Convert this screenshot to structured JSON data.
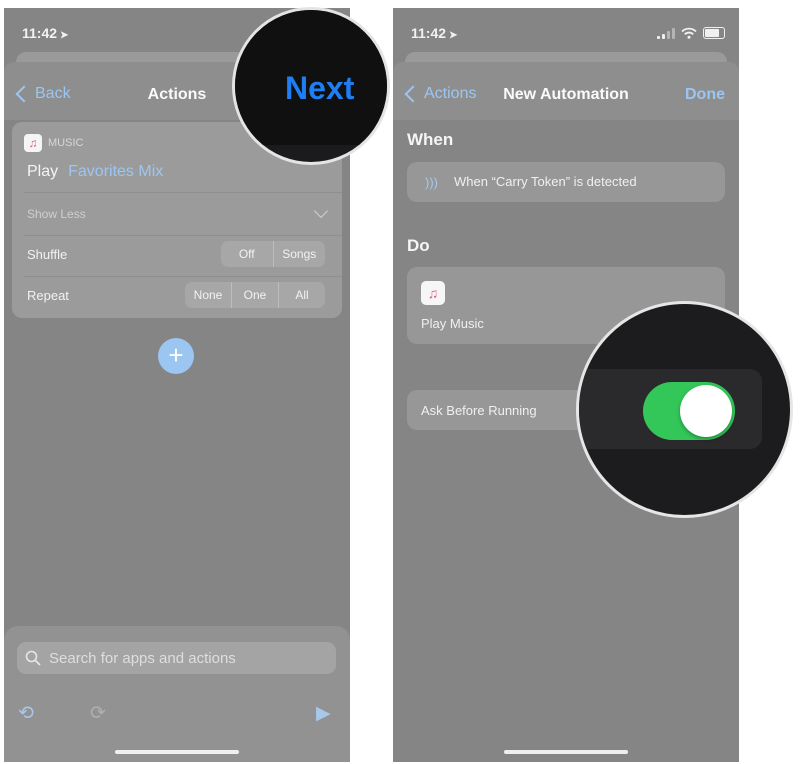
{
  "left": {
    "status": {
      "time": "11:42"
    },
    "nav": {
      "back": "Back",
      "title": "Actions",
      "next": "Next"
    },
    "action_card": {
      "app_name": "MUSIC",
      "action": "Play",
      "parameter": "Favorites Mix",
      "show_less": "Show Less",
      "shuffle": {
        "label": "Shuffle",
        "options": [
          "Off",
          "Songs"
        ]
      },
      "repeat": {
        "label": "Repeat",
        "options": [
          "None",
          "One",
          "All"
        ]
      }
    },
    "add_button": "+",
    "search": {
      "placeholder": "Search for apps and actions"
    }
  },
  "right": {
    "status": {
      "time": "11:42"
    },
    "nav": {
      "back": "Actions",
      "title": "New Automation",
      "done": "Done"
    },
    "when": {
      "header": "When",
      "trigger": "When “Carry Token” is detected"
    },
    "do": {
      "header": "Do",
      "action": "Play Music"
    },
    "ask_before_running": {
      "label": "Ask Before Running",
      "enabled": true
    }
  },
  "zoom": {
    "next_label": "Next"
  },
  "colors": {
    "accent": "#1e7ef4",
    "toggle_on": "#33c759"
  },
  "icons": [
    "location-arrow-icon",
    "back-chevron-icon",
    "music-icon",
    "chevron-down-icon",
    "plus-icon",
    "search-icon",
    "undo-icon",
    "redo-icon",
    "play-icon",
    "signal-icon",
    "wifi-icon",
    "battery-icon",
    "nfc-icon"
  ]
}
